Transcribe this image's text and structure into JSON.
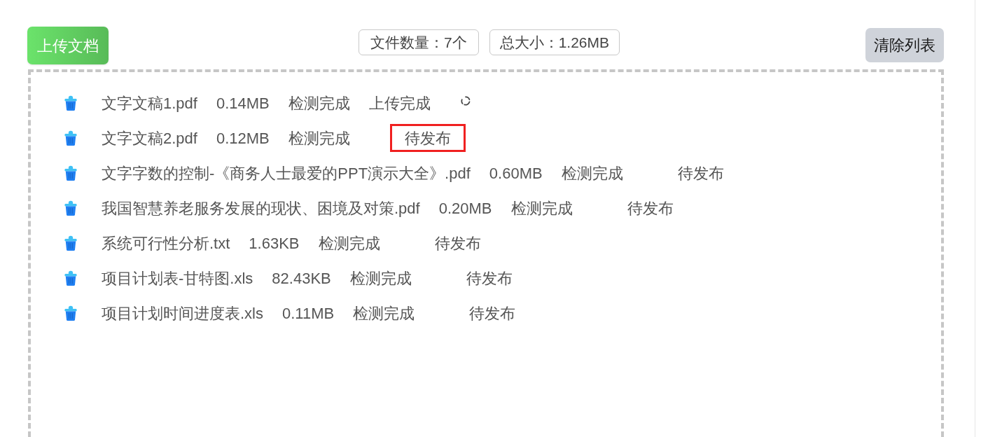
{
  "toolbar": {
    "upload_button": "上传文档",
    "file_count": "文件数量：7个",
    "total_size": "总大小：1.26MB",
    "clear_button": "清除列表"
  },
  "files": [
    {
      "kind": "uploading",
      "name": "文字文稿1.pdf",
      "size": "0.14MB",
      "check_status": "检测完成",
      "upload_status": "上传完成",
      "highlighted": false
    },
    {
      "kind": "pending",
      "name": "文字文稿2.pdf",
      "size": "0.12MB",
      "check_status": "检测完成",
      "publish_status": "待发布",
      "highlighted": true
    },
    {
      "kind": "pending",
      "name": "文字字数的控制-《商务人士最爱的PPT演示大全》.pdf",
      "size": "0.60MB",
      "check_status": "检测完成",
      "publish_status": "待发布",
      "highlighted": false
    },
    {
      "kind": "pending",
      "name": "我国智慧养老服务发展的现状、困境及对策.pdf",
      "size": "0.20MB",
      "check_status": "检测完成",
      "publish_status": "待发布",
      "highlighted": false
    },
    {
      "kind": "pending",
      "name": "系统可行性分析.txt",
      "size": "1.63KB",
      "check_status": "检测完成",
      "publish_status": "待发布",
      "highlighted": false
    },
    {
      "kind": "pending",
      "name": "项目计划表-甘特图.xls",
      "size": "82.43KB",
      "check_status": "检测完成",
      "publish_status": "待发布",
      "highlighted": false
    },
    {
      "kind": "pending",
      "name": "项目计划时间进度表.xls",
      "size": "0.11MB",
      "check_status": "检测完成",
      "publish_status": "待发布",
      "highlighted": false
    }
  ]
}
